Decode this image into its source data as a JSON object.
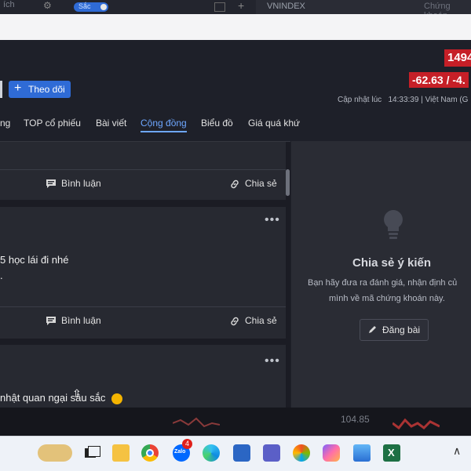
{
  "topbar": {
    "fragment": "ích",
    "toggle_label": "Sắc",
    "search_text": "VNINDEX",
    "search_hint": "Chứng khoán"
  },
  "header": {
    "follow_label": "Theo dõi",
    "price": "1494",
    "change": "-62.63 / -4.",
    "updated_label": "Cập nhật lúc",
    "updated_time": "14:33:39",
    "updated_region": "| Việt Nam (G"
  },
  "tabs": [
    {
      "label": "ng"
    },
    {
      "label": "TOP cổ phiếu"
    },
    {
      "label": "Bài viết"
    },
    {
      "label": "Cộng đồng",
      "active": true
    },
    {
      "label": "Biểu đồ"
    },
    {
      "label": "Giá quá khứ"
    }
  ],
  "feed": {
    "comment_label": "Bình luận",
    "share_label": "Chia sẻ",
    "post1_text": "5 học lái đi nhé",
    "post1_text2": ".",
    "post2_text": "nhật quan ngại sâu sắc"
  },
  "panel": {
    "title": "Chia sẻ ý kiến",
    "desc_line1": "Bạn hãy đưa ra đánh giá, nhận định củ",
    "desc_line2": "mình về mã chứng khoán này.",
    "post_button": "Đăng bài"
  },
  "strip": {
    "value": "104.85"
  },
  "taskbar": {
    "zalo_badge": "4",
    "zalo_label": "Zalo"
  },
  "colors": {
    "accent": "#2f6bd6",
    "down": "#c61f27",
    "active_tab": "#6ea7ff"
  }
}
